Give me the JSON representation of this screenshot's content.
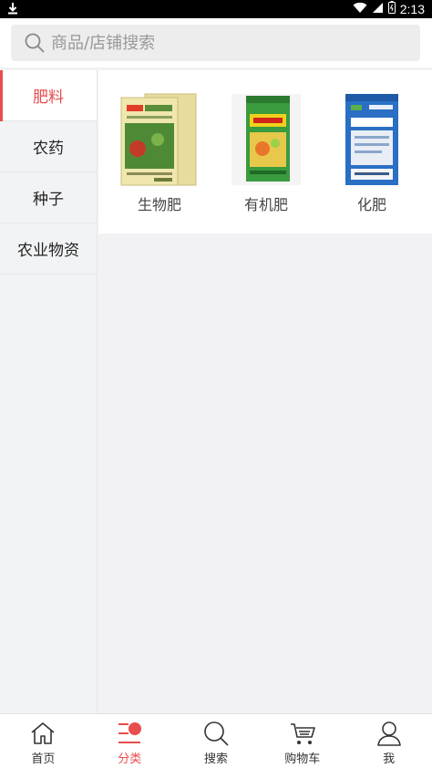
{
  "status_bar": {
    "time": "2:13"
  },
  "search": {
    "placeholder": "商品/店铺搜索"
  },
  "sidebar": {
    "items": [
      {
        "label": "肥料",
        "active": true
      },
      {
        "label": "农药",
        "active": false
      },
      {
        "label": "种子",
        "active": false
      },
      {
        "label": "农业物资",
        "active": false
      }
    ]
  },
  "products": [
    {
      "name": "生物肥",
      "icon": "fertilizer-bag-bio"
    },
    {
      "name": "有机肥",
      "icon": "fertilizer-bag-organic"
    },
    {
      "name": "化肥",
      "icon": "fertilizer-bag-chemical"
    }
  ],
  "bottom_nav": {
    "items": [
      {
        "label": "首页",
        "icon": "home-icon"
      },
      {
        "label": "分类",
        "icon": "category-icon",
        "active": true
      },
      {
        "label": "搜索",
        "icon": "search-icon"
      },
      {
        "label": "购物车",
        "icon": "cart-icon"
      },
      {
        "label": "我",
        "icon": "user-icon"
      }
    ]
  },
  "colors": {
    "accent": "#e84d4d",
    "sidebar_bg": "#f2f3f5",
    "page_bg": "#f2f2f4"
  }
}
